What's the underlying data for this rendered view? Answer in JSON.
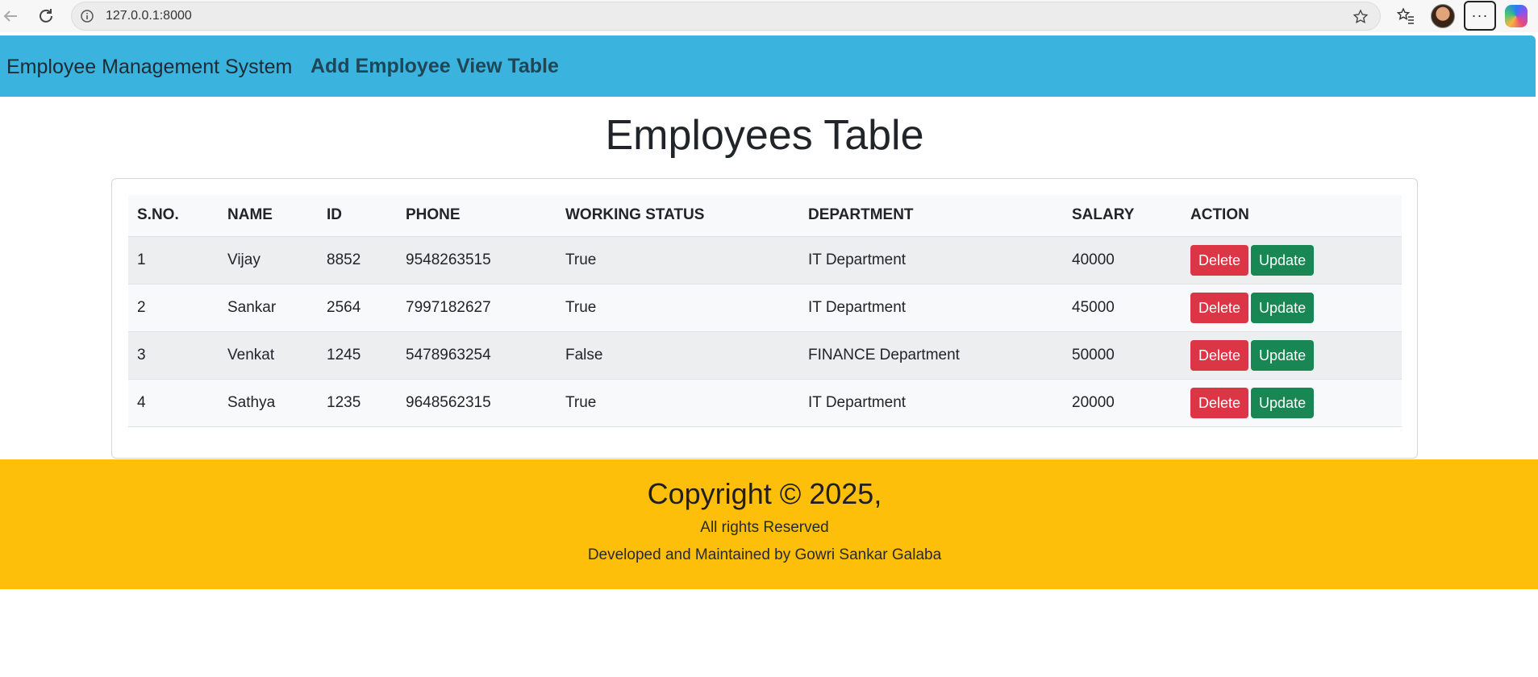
{
  "browser": {
    "url": "127.0.0.1:8000",
    "menu_label": "···"
  },
  "nav": {
    "brand": "Employee Management System",
    "links": [
      "Add Employee",
      "View Table"
    ]
  },
  "page": {
    "title": "Employees Table"
  },
  "table": {
    "headers": [
      "S.NO.",
      "NAME",
      "ID",
      "PHONE",
      "WORKING STATUS",
      "DEPARTMENT",
      "SALARY",
      "ACTION"
    ],
    "rows": [
      [
        "1",
        "Vijay",
        "8852",
        "9548263515",
        "True",
        "IT Department",
        "40000"
      ],
      [
        "2",
        "Sankar",
        "2564",
        "7997182627",
        "True",
        "IT Department",
        "45000"
      ],
      [
        "3",
        "Venkat",
        "1245",
        "5478963254",
        "False",
        "FINANCE Department",
        "50000"
      ],
      [
        "4",
        "Sathya",
        "1235",
        "9648562315",
        "True",
        "IT Department",
        "20000"
      ]
    ],
    "delete_label": "Delete",
    "update_label": "Update"
  },
  "footer": {
    "copyright": "Copyright © 2025,",
    "rights": "All rights Reserved",
    "developer": "Developed and Maintained by Gowri Sankar Galaba"
  },
  "colors": {
    "navbar": "#3ab4de",
    "footer": "#fdbf0a",
    "delete": "#dc3545",
    "update": "#198754"
  }
}
